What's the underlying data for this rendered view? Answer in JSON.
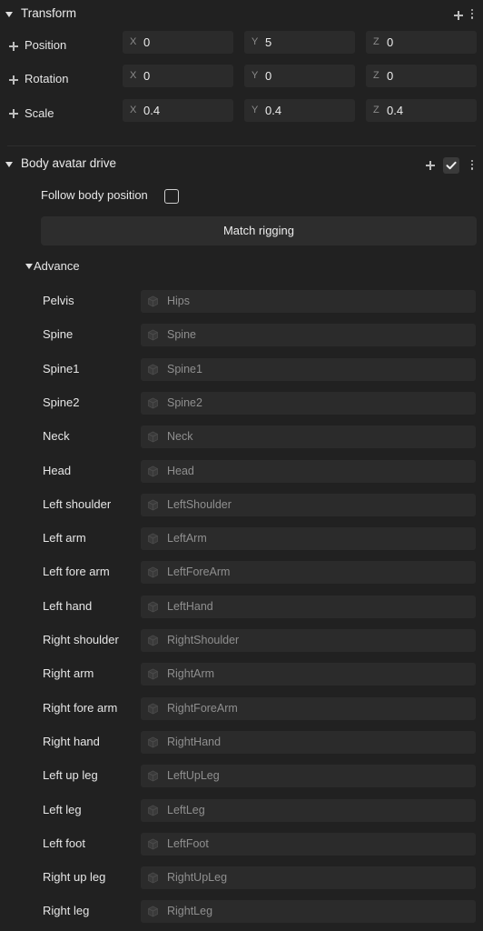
{
  "transform": {
    "title": "Transform",
    "rows": [
      {
        "label": "Position",
        "x": "0",
        "y": "5",
        "z": "0"
      },
      {
        "label": "Rotation",
        "x": "0",
        "y": "0",
        "z": "0"
      },
      {
        "label": "Scale",
        "x": "0.4",
        "y": "0.4",
        "z": "0.4"
      }
    ],
    "axis": {
      "x": "X",
      "y": "Y",
      "z": "Z"
    }
  },
  "body_drive": {
    "title": "Body avatar drive",
    "enabled": true,
    "follow_label": "Follow body position",
    "follow_checked": false,
    "match_button": "Match rigging",
    "advance_label": "Advance",
    "bones": [
      {
        "name": "Pelvis",
        "value": "Hips"
      },
      {
        "name": "Spine",
        "value": "Spine"
      },
      {
        "name": "Spine1",
        "value": "Spine1"
      },
      {
        "name": "Spine2",
        "value": "Spine2"
      },
      {
        "name": "Neck",
        "value": "Neck"
      },
      {
        "name": "Head",
        "value": "Head"
      },
      {
        "name": "Left shoulder",
        "value": "LeftShoulder"
      },
      {
        "name": "Left arm",
        "value": "LeftArm"
      },
      {
        "name": "Left fore arm",
        "value": "LeftForeArm"
      },
      {
        "name": "Left hand",
        "value": "LeftHand"
      },
      {
        "name": "Right shoulder",
        "value": "RightShoulder"
      },
      {
        "name": "Right arm",
        "value": "RightArm"
      },
      {
        "name": "Right fore arm",
        "value": "RightForeArm"
      },
      {
        "name": "Right hand",
        "value": "RightHand"
      },
      {
        "name": "Left up leg",
        "value": "LeftUpLeg"
      },
      {
        "name": "Left leg",
        "value": "LeftLeg"
      },
      {
        "name": "Left foot",
        "value": "LeftFoot"
      },
      {
        "name": "Right up leg",
        "value": "RightUpLeg"
      },
      {
        "name": "Right leg",
        "value": "RightLeg"
      }
    ]
  }
}
